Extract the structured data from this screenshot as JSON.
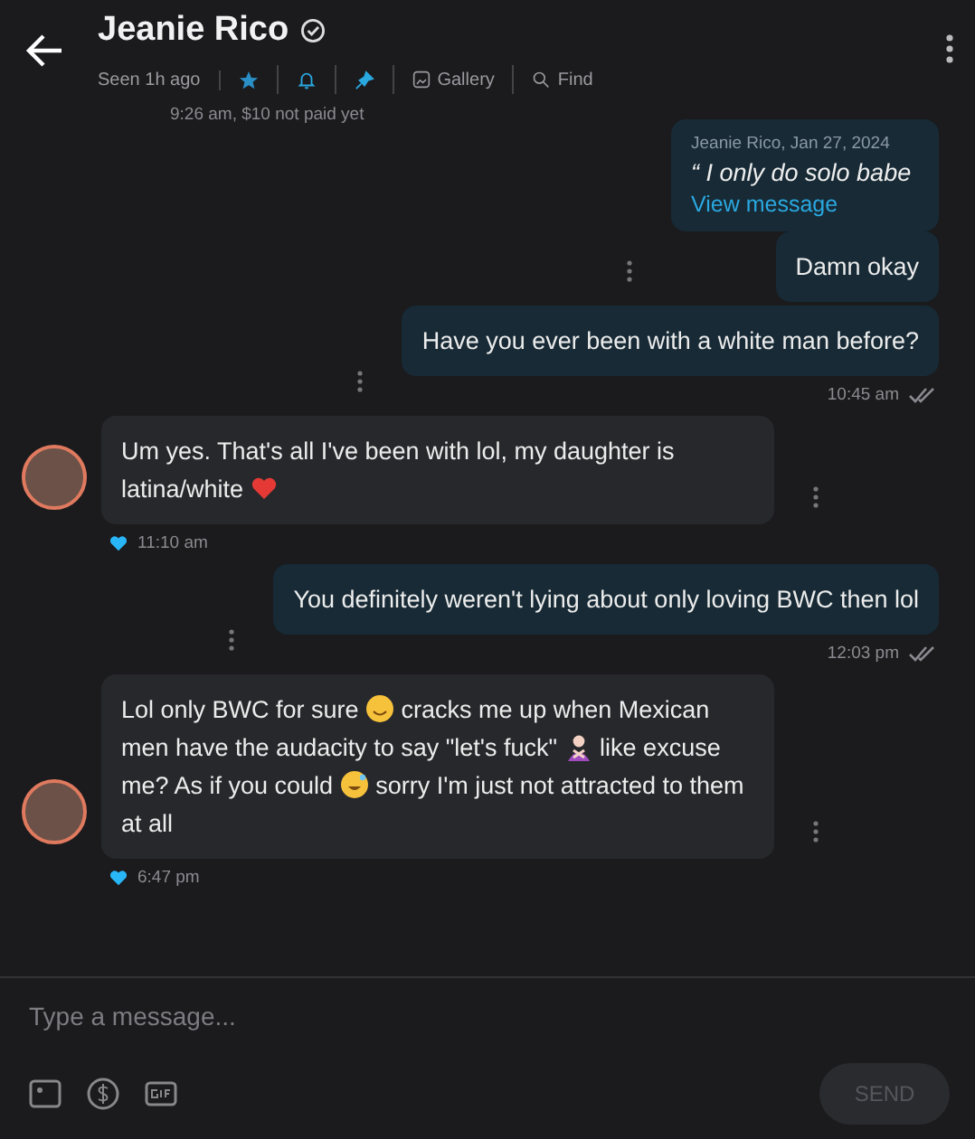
{
  "header": {
    "name": "Jeanie Rico",
    "verified": true,
    "status": "Seen 1h ago",
    "actions": [
      {
        "kind": "star"
      },
      {
        "kind": "bell"
      },
      {
        "kind": "pin"
      },
      {
        "kind": "gallery",
        "label": "Gallery"
      },
      {
        "kind": "find",
        "label": "Find"
      }
    ],
    "note": "9:26 am, $10 not paid yet"
  },
  "messages": [
    {
      "kind": "out",
      "quote": {
        "meta": "Jeanie Rico, Jan 27, 2024",
        "text": "“ I only do solo babe",
        "link": "View message"
      },
      "parts": [
        {
          "kind": "text",
          "text": "Damn okay"
        }
      ]
    },
    {
      "kind": "out",
      "parts": [
        {
          "kind": "text",
          "text": "Have you ever been with a white man before?"
        }
      ],
      "time": "10:45 am",
      "read": true
    },
    {
      "kind": "in",
      "parts": [
        {
          "kind": "text",
          "text": "Um yes. That's all I've been with lol, my daughter is latina/white "
        },
        {
          "kind": "heart"
        }
      ],
      "time": "11:10 am",
      "liked": true
    },
    {
      "kind": "out",
      "parts": [
        {
          "kind": "text",
          "text": "You definitely weren't lying about only loving BWC then lol"
        }
      ],
      "time": "12:03 pm",
      "read": true
    },
    {
      "kind": "in",
      "parts": [
        {
          "kind": "text",
          "text": "Lol only BWC for sure "
        },
        {
          "kind": "grin"
        },
        {
          "kind": "text",
          "text": " cracks me up when Mexican men have the audacity to say \"let's fuck\" "
        },
        {
          "kind": "cross"
        },
        {
          "kind": "text",
          "text": " like excuse me? As if you could "
        },
        {
          "kind": "sweat"
        },
        {
          "kind": "text",
          "text": " sorry I'm just not attracted to them at all"
        }
      ],
      "time": "6:47 pm",
      "liked": true
    }
  ],
  "composer": {
    "placeholder": "Type a message...",
    "send": "SEND",
    "send_disabled": true
  }
}
